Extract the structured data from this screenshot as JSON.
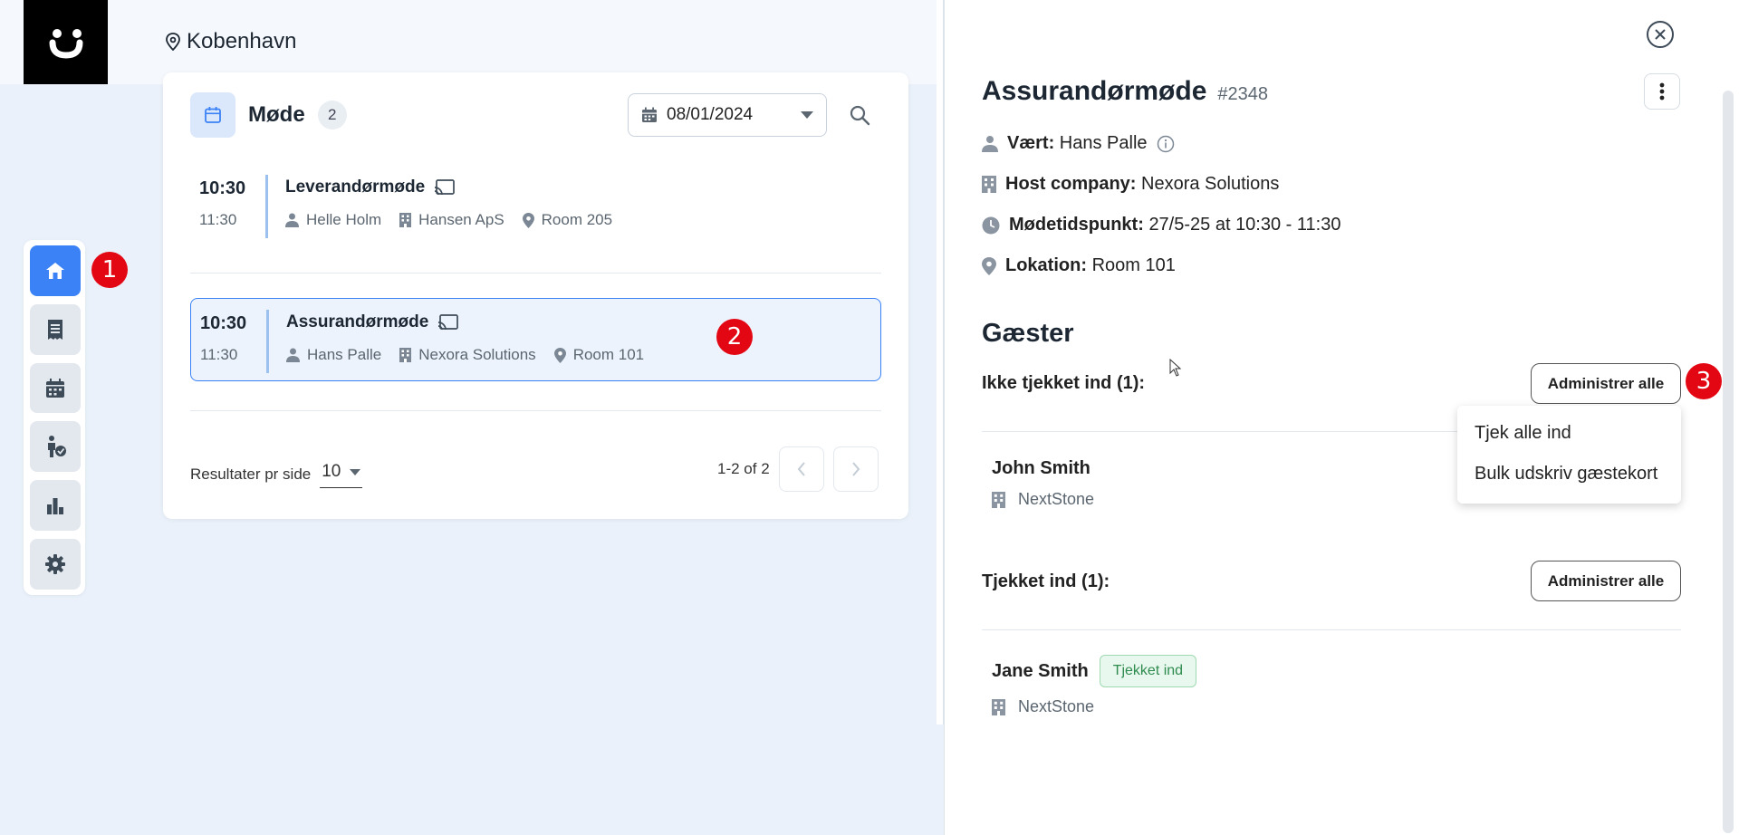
{
  "header": {
    "location": "Kobenhavn"
  },
  "nav": {
    "items": [
      {
        "name": "home",
        "active": true
      },
      {
        "name": "receipt"
      },
      {
        "name": "calendar"
      },
      {
        "name": "guest-checkin"
      },
      {
        "name": "statistics"
      },
      {
        "name": "settings"
      }
    ]
  },
  "markers": [
    "1",
    "2",
    "3"
  ],
  "meetings_panel": {
    "title": "Møde",
    "count": "2",
    "date": "08/01/2024",
    "meetings": [
      {
        "start": "10:30",
        "end": "11:30",
        "title": "Leverandørmøde",
        "host": "Helle Holm",
        "company": "Hansen ApS",
        "room": "Room 205",
        "selected": false
      },
      {
        "start": "10:30",
        "end": "11:30",
        "title": "Assurandørmøde",
        "host": "Hans Palle",
        "company": "Nexora Solutions",
        "room": "Room 101",
        "selected": true
      }
    ],
    "per_page_label": "Resultater pr side",
    "per_page_value": "10",
    "range_label": "1-2 of 2"
  },
  "detail": {
    "title": "Assurandørmøde",
    "number": "#2348",
    "host_label": "Vært:",
    "host_value": "Hans Palle",
    "company_label": "Host company:",
    "company_value": "Nexora Solutions",
    "time_label": "Mødetidspunkt:",
    "time_value": "27/5-25 at 10:30 - 11:30",
    "location_label": "Lokation:",
    "location_value": "Room 101",
    "guests_title": "Gæster",
    "not_checked_label": "Ikke tjekket ind (1):",
    "checked_label": "Tjekket ind (1):",
    "admin_all_label": "Administrer alle",
    "not_checked_guests": [
      {
        "name": "John Smith",
        "company": "NextStone"
      }
    ],
    "checked_guests": [
      {
        "name": "Jane Smith",
        "company": "NextStone",
        "badge": "Tjekket ind"
      }
    ],
    "dropdown_options": [
      "Tjek alle ind",
      "Bulk udskriv gæstekort"
    ]
  },
  "colors": {
    "accent": "#3b82f6",
    "marker": "#e30613",
    "success": "#2e8b4e"
  }
}
